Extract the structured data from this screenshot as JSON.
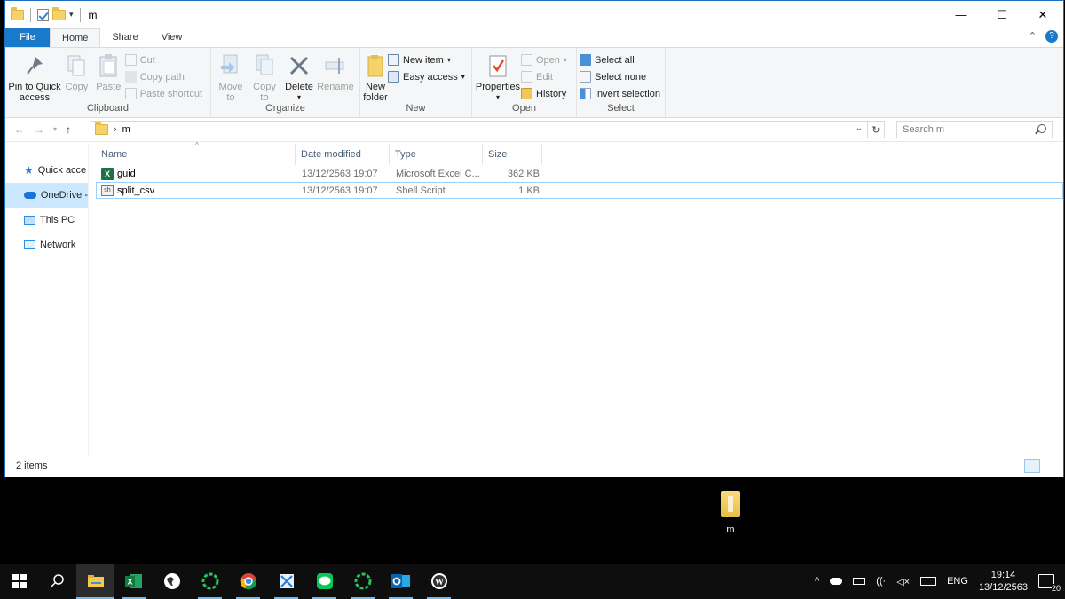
{
  "window": {
    "title": "m",
    "controls": {
      "minimize": "—",
      "maximize": "☐",
      "close": "✕"
    }
  },
  "tabs": [
    {
      "label": "File"
    },
    {
      "label": "Home"
    },
    {
      "label": "Share"
    },
    {
      "label": "View"
    }
  ],
  "ribbon": {
    "clipboard": {
      "label": "Clipboard",
      "pin_line1": "Pin to Quick",
      "pin_line2": "access",
      "copy": "Copy",
      "paste": "Paste",
      "cut": "Cut",
      "copy_path": "Copy path",
      "paste_shortcut": "Paste shortcut"
    },
    "organize": {
      "label": "Organize",
      "move_line1": "Move",
      "move_line2": "to",
      "copy_line1": "Copy",
      "copy_line2": "to",
      "delete": "Delete",
      "rename": "Rename"
    },
    "new": {
      "label": "New",
      "folder_line1": "New",
      "folder_line2": "folder",
      "new_item": "New item",
      "easy_access": "Easy access"
    },
    "open": {
      "label": "Open",
      "properties": "Properties",
      "open": "Open",
      "edit": "Edit",
      "history": "History"
    },
    "select": {
      "label": "Select",
      "select_all": "Select all",
      "select_none": "Select none",
      "invert": "Invert selection"
    }
  },
  "address": {
    "path": "m",
    "search_placeholder": "Search m"
  },
  "navpane": [
    {
      "label": "Quick acce",
      "icon": "star-icon"
    },
    {
      "label": "OneDrive -",
      "icon": "cloud-icon"
    },
    {
      "label": "This PC",
      "icon": "computer-icon"
    },
    {
      "label": "Network",
      "icon": "network-icon"
    }
  ],
  "columns": {
    "name": "Name",
    "date": "Date modified",
    "type": "Type",
    "size": "Size"
  },
  "files": [
    {
      "name": "guid",
      "date": "13/12/2563 19:07",
      "type": "Microsoft Excel C...",
      "size": "362 KB",
      "icon": "excel-icon",
      "icon_text": "X"
    },
    {
      "name": "split_csv",
      "date": "13/12/2563 19:07",
      "type": "Shell Script",
      "size": "1 KB",
      "icon": "script-icon",
      "icon_text": "sh"
    }
  ],
  "status": {
    "items": "2 items"
  },
  "desktop": {
    "icon_label": "m"
  },
  "taskbar": {
    "lang": "ENG",
    "time": "19:14",
    "date": "13/12/2563",
    "notifications": "20"
  },
  "colors": {
    "accent": "#1979ca",
    "selection": "#cce8ff",
    "taskbar": "#0e0e0e"
  }
}
